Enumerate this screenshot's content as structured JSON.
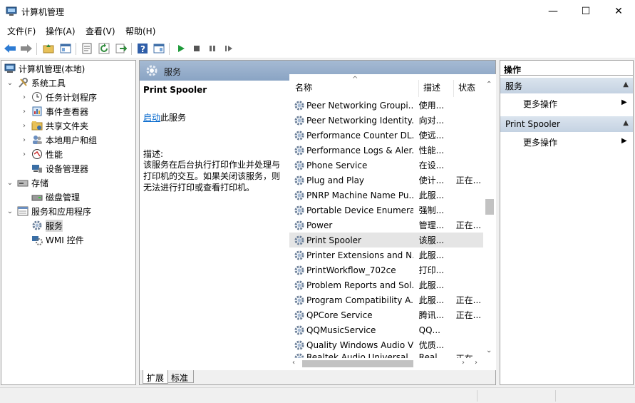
{
  "window": {
    "title": "计算机管理",
    "minimize": "—",
    "maximize": "☐",
    "close": "✕"
  },
  "menu": {
    "items": [
      "文件(F)",
      "操作(A)",
      "查看(V)",
      "帮助(H)"
    ]
  },
  "tree": {
    "root": "计算机管理(本地)",
    "system_tools": "系统工具",
    "task_scheduler": "任务计划程序",
    "event_viewer": "事件查看器",
    "shared_folders": "共享文件夹",
    "local_users": "本地用户和组",
    "performance": "性能",
    "device_manager": "设备管理器",
    "storage": "存储",
    "disk_management": "磁盘管理",
    "services_apps": "服务和应用程序",
    "services": "服务",
    "wmi": "WMI 控件"
  },
  "center": {
    "header": "服务",
    "selected_title": "Print Spooler",
    "start_link": "启动",
    "start_suffix": "此服务",
    "desc_label": "描述:",
    "desc_text": "该服务在后台执行打印作业并处理与打印机的交互。如果关闭该服务，则无法进行打印或查看打印机。",
    "columns": {
      "name": "名称",
      "desc": "描述",
      "status": "状态"
    },
    "sort_glyph": "^",
    "rows": [
      {
        "name": "Peer Networking Groupi...",
        "desc": "使用...",
        "status": ""
      },
      {
        "name": "Peer Networking Identity...",
        "desc": "向对...",
        "status": ""
      },
      {
        "name": "Performance Counter DL...",
        "desc": "使远...",
        "status": ""
      },
      {
        "name": "Performance Logs & Aler...",
        "desc": "性能...",
        "status": ""
      },
      {
        "name": "Phone Service",
        "desc": "在设...",
        "status": ""
      },
      {
        "name": "Plug and Play",
        "desc": "使计...",
        "status": "正在..."
      },
      {
        "name": "PNRP Machine Name Pu...",
        "desc": "此服...",
        "status": ""
      },
      {
        "name": "Portable Device Enumera...",
        "desc": "强制...",
        "status": ""
      },
      {
        "name": "Power",
        "desc": "管理...",
        "status": "正在..."
      },
      {
        "name": "Print Spooler",
        "desc": "该服...",
        "status": ""
      },
      {
        "name": "Printer Extensions and N...",
        "desc": "此服...",
        "status": ""
      },
      {
        "name": "PrintWorkflow_702ce",
        "desc": "打印...",
        "status": ""
      },
      {
        "name": "Problem Reports and Sol...",
        "desc": "此服...",
        "status": ""
      },
      {
        "name": "Program Compatibility A...",
        "desc": "此服...",
        "status": "正在..."
      },
      {
        "name": "QPCore Service",
        "desc": "腾讯...",
        "status": "正在..."
      },
      {
        "name": "QQMusicService",
        "desc": "QQ...",
        "status": ""
      },
      {
        "name": "Quality Windows Audio V...",
        "desc": "优质...",
        "status": ""
      },
      {
        "name": "Realtek Audio Universal ...",
        "desc": "Real...",
        "status": "正在..."
      }
    ],
    "selected_index": 9,
    "tabs": [
      "扩展",
      "标准"
    ]
  },
  "actions": {
    "title": "操作",
    "section1": "服务",
    "more1": "更多操作",
    "section2": "Print Spooler",
    "more2": "更多操作"
  },
  "colors": {
    "header_blue": "#8aa4c4",
    "link": "#0066cc",
    "selection": "#e5e5e5",
    "action_header": "#c4d2e2"
  },
  "icons": {
    "service": "gear-icon",
    "back": "back-arrow-icon",
    "forward": "forward-arrow-icon",
    "play": "play-icon",
    "stop": "stop-icon",
    "pause": "pause-icon",
    "restart": "restart-icon"
  }
}
